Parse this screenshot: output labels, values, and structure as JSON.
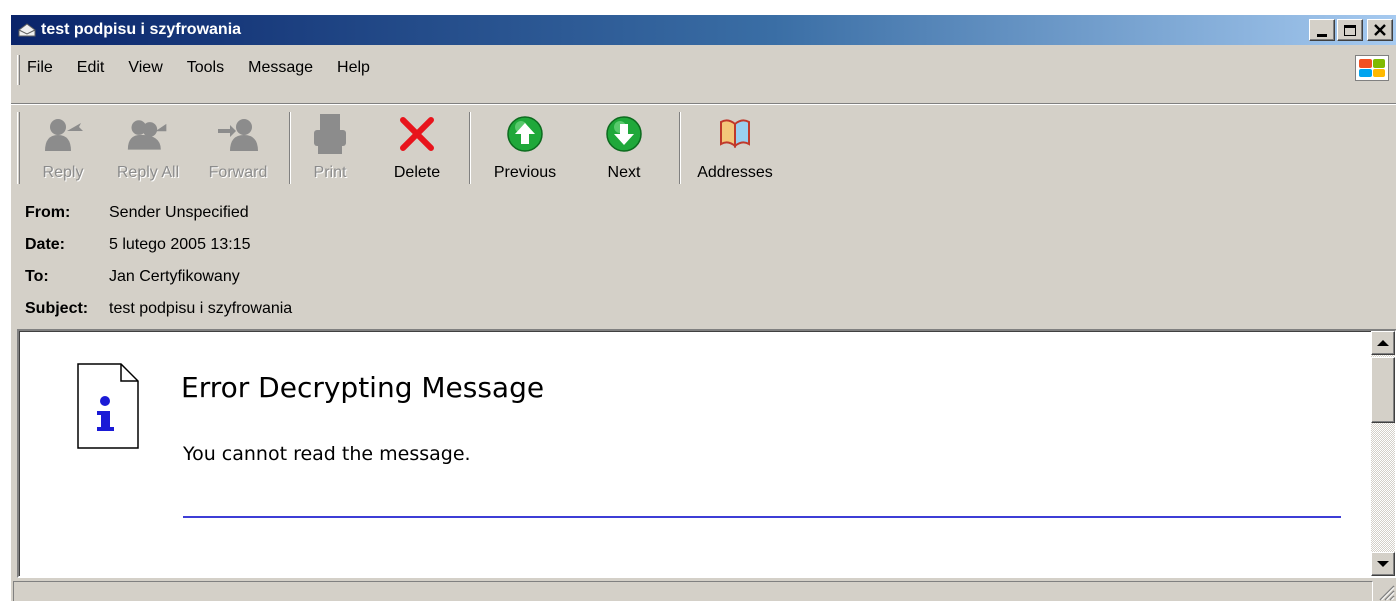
{
  "window": {
    "title": "test podpisu i szyfrowania"
  },
  "menu": {
    "items": [
      {
        "label": "File"
      },
      {
        "label": "Edit"
      },
      {
        "label": "View"
      },
      {
        "label": "Tools"
      },
      {
        "label": "Message"
      },
      {
        "label": "Help"
      }
    ]
  },
  "toolbar": {
    "reply": "Reply",
    "reply_all": "Reply All",
    "forward": "Forward",
    "print": "Print",
    "delete": "Delete",
    "previous": "Previous",
    "next": "Next",
    "addresses": "Addresses"
  },
  "headers": {
    "from_label": "From:",
    "from_value": "Sender Unspecified",
    "date_label": "Date:",
    "date_value": "5 lutego 2005 13:15",
    "to_label": "To:",
    "to_value": "Jan Certyfikowany",
    "subject_label": "Subject:",
    "subject_value": "test podpisu i szyfrowania"
  },
  "message": {
    "title": "Error Decrypting Message",
    "body": "You cannot read the message."
  },
  "colors": {
    "title_bar_start": "#0a246a",
    "title_bar_end": "#a6caf0",
    "face": "#d4d0c8",
    "rule": "#3e3ed6",
    "delete_red": "#e8141c",
    "nav_green": "#1fa83a"
  },
  "icons": [
    "window-icon",
    "minimize-icon",
    "maximize-icon",
    "close-icon",
    "windows-logo-icon",
    "reply-icon",
    "reply-all-icon",
    "forward-icon",
    "print-icon",
    "delete-icon",
    "previous-icon",
    "next-icon",
    "addresses-icon",
    "info-document-icon",
    "scroll-up-icon",
    "scroll-down-icon",
    "resize-grip-icon"
  ]
}
